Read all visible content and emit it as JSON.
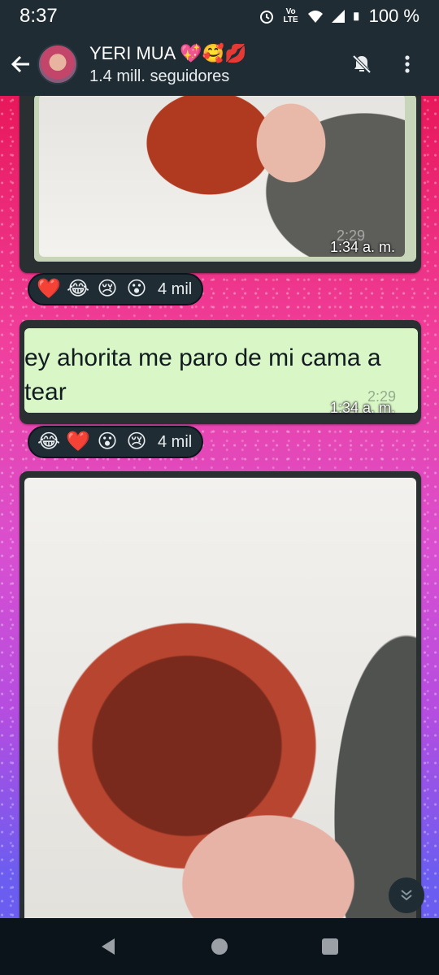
{
  "status_bar": {
    "time": "8:37",
    "volte": "Vo LTE",
    "battery": "100 %"
  },
  "header": {
    "channel_name": "YERI MUA 💖🥰💋",
    "subtitle": "1.4 mill. seguidores"
  },
  "messages": [
    {
      "type": "image",
      "timestamp": "1:34 a. m.",
      "ghost_time": "2:29",
      "reactions": [
        "❤️",
        "😂",
        "😢",
        "😮"
      ],
      "reaction_count": "4 mil"
    },
    {
      "type": "text",
      "lines": [
        "ey ahorita me paro de mi cama a",
        "tear"
      ],
      "timestamp": "1:34 a. m.",
      "ghost_time": "2:29",
      "reactions": [
        "😂",
        "❤️",
        "😮",
        "😢"
      ],
      "reaction_count": "4 mil"
    },
    {
      "type": "image"
    }
  ],
  "colors": {
    "header_bg": "#1f2c34",
    "bubble_bg": "#2a2f32",
    "text_card_bg": "#d9f7c6",
    "wallpaper_top": "#e8175a",
    "wallpaper_bottom": "#6b5df0"
  }
}
